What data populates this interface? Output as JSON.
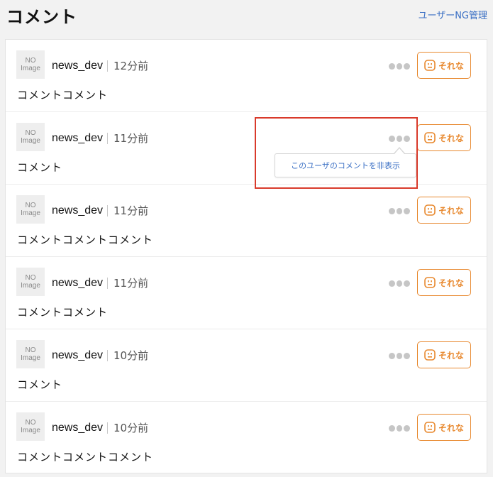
{
  "header": {
    "title": "コメント",
    "ng_link": "ユーザーNG管理"
  },
  "comments": [
    {
      "avatar_line1": "NO",
      "avatar_line2": "Image",
      "user": "news_dev",
      "time": "12分前",
      "text": "コメントコメント",
      "reaction": "それな"
    },
    {
      "avatar_line1": "NO",
      "avatar_line2": "Image",
      "user": "news_dev",
      "time": "11分前",
      "text": "コメント",
      "reaction": "それな"
    },
    {
      "avatar_line1": "NO",
      "avatar_line2": "Image",
      "user": "news_dev",
      "time": "11分前",
      "text": "コメントコメントコメント",
      "reaction": "それな"
    },
    {
      "avatar_line1": "NO",
      "avatar_line2": "Image",
      "user": "news_dev",
      "time": "11分前",
      "text": "コメントコメント",
      "reaction": "それな"
    },
    {
      "avatar_line1": "NO",
      "avatar_line2": "Image",
      "user": "news_dev",
      "time": "10分前",
      "text": "コメント",
      "reaction": "それな"
    },
    {
      "avatar_line1": "NO",
      "avatar_line2": "Image",
      "user": "news_dev",
      "time": "10分前",
      "text": "コメントコメントコメント",
      "reaction": "それな"
    }
  ],
  "popup": {
    "hide_user_comments": "このユーザのコメントを非表示"
  },
  "colors": {
    "accent_orange": "#e8892f",
    "link_blue": "#3a6fc4",
    "highlight_red": "#d93a2b"
  },
  "icons": {
    "menu": "more-dots-icon",
    "reaction": "face-icon"
  }
}
